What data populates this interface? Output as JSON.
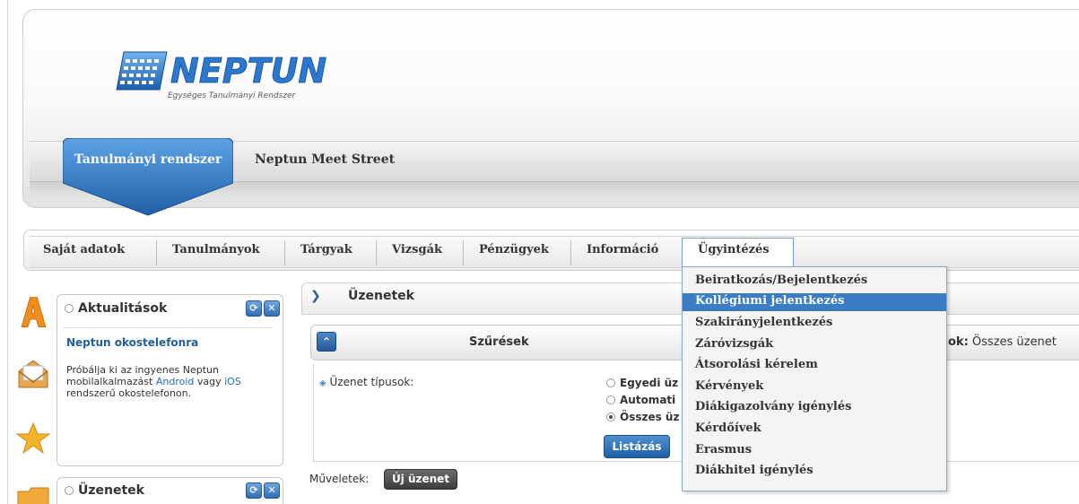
{
  "brand": {
    "name": "NEPTUN",
    "subtitle": "Egységes Tanulmányi Rendszer",
    "blue": "#2f7fd6",
    "dark_blue": "#1f5fa6"
  },
  "system_tabs": {
    "active": "Tanulmányi rendszer",
    "other": "Neptun Meet Street"
  },
  "main_menu": {
    "items": [
      "Saját adatok",
      "Tanulmányok",
      "Tárgyak",
      "Vizsgák",
      "Pénzügyek",
      "Információ",
      "Ügyintézés"
    ],
    "open_item": "Ügyintézés"
  },
  "dropdown": {
    "items": [
      "Beiratkozás/Bejelentkezés",
      "Kollégiumi jelentkezés",
      "Szakirányjelentkezés",
      "Záróvizsgák",
      "Átsorolási kérelem",
      "Kérvények",
      "Diákigazolvány igénylés",
      "Kérdőívek",
      "Erasmus",
      "Diákhitel igénylés"
    ],
    "highlighted": "Kollégiumi jelentkezés",
    "highlight_color": "#3b7dc4"
  },
  "sidebar": {
    "icons": [
      "aktualitasok-a-icon",
      "envelope-icon",
      "star-icon",
      "folder-icon"
    ],
    "news_portlet": {
      "title": "Aktualitások",
      "news_title": "Neptun okostelefonra",
      "body_pre": "Próbálja ki az ingyenes Neptun mobilalkalmazást ",
      "link_android": "Android",
      "body_mid": " vagy ",
      "link_ios": "iOS",
      "body_post": " rendszerű okostelefonon."
    },
    "messages_portlet": {
      "title": "Üzenetek"
    }
  },
  "content": {
    "title": "Üzenetek",
    "filter": {
      "title": "Szűrések",
      "right_label_bold": "ok:",
      "right_label_value": " Összes üzenet",
      "message_types_label": "Üzenet típusok:",
      "options": [
        "Egyedi üz",
        "Automati",
        "Összes üz"
      ],
      "selected_index": 2,
      "list_button": "Listázás"
    },
    "operations_label": "Műveletek:",
    "new_message_button": "Új üzenet"
  }
}
